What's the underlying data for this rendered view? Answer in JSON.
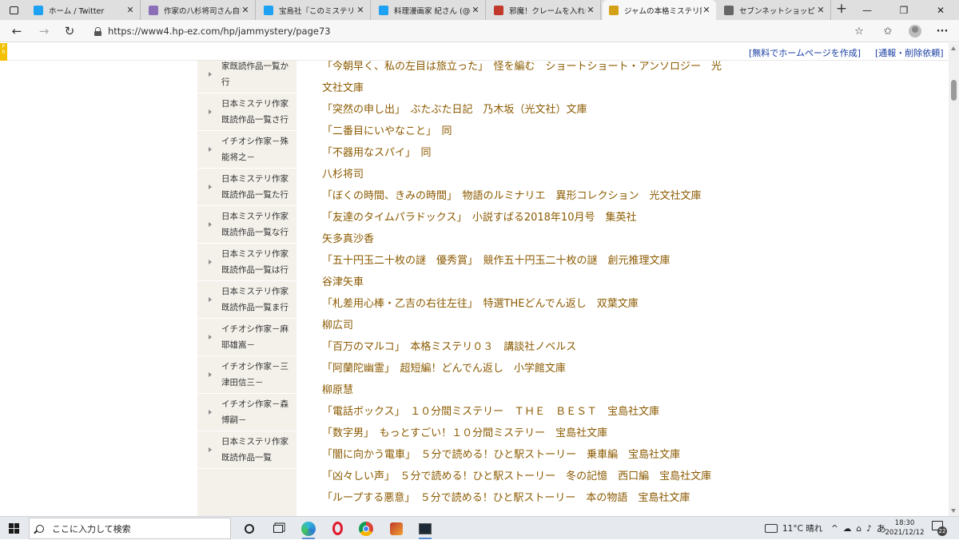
{
  "browser": {
    "tabs": [
      {
        "title": "ホーム / Twitter",
        "favicon": "twitter-icon",
        "color": "#1da1f2",
        "active": false
      },
      {
        "title": "作家の八杉将司さん自宅",
        "favicon": "news-icon",
        "color": "#8a6fb8",
        "active": false
      },
      {
        "title": "宝島社『このミステリーがすご",
        "favicon": "twitter-icon",
        "color": "#1da1f2",
        "active": false
      },
      {
        "title": "料理漫画家 紀さん (@syase",
        "favicon": "twitter-icon",
        "color": "#1da1f2",
        "active": false
      },
      {
        "title": "邪魔！クレームを入れ会社",
        "favicon": "web-icon",
        "color": "#c0392b",
        "active": false
      },
      {
        "title": "ジャムの本格ミステリ館 短",
        "favicon": "jam-icon",
        "color": "#d4a017",
        "active": true
      },
      {
        "title": "セブンネットショッピング｜本",
        "favicon": "shop-icon",
        "color": "#666666",
        "active": false
      }
    ],
    "url": "https://www4.hp-ez.com/hp/jammystery/page73"
  },
  "infobar": {
    "create_link": "[無料でホームページを作成]",
    "report_link": "[通報・削除依頼]"
  },
  "sidebar": {
    "items": [
      "家既読作品一覧か行",
      "日本ミステリ作家既読作品一覧さ行",
      "イチオシ作家－殊能将之－",
      "日本ミステリ作家既読作品一覧た行",
      "日本ミステリ作家既読作品一覧な行",
      "日本ミステリ作家既読作品一覧は行",
      "日本ミステリ作家既読作品一覧ま行",
      "イチオシ作家－麻耶雄嵩－",
      "イチオシ作家－三津田信三－",
      "イチオシ作家－森博嗣－",
      "日本ミステリ作家既読作品一覧"
    ]
  },
  "main": {
    "first_line": "「今朝早く、私の左目は旅立った」　怪を編む　ショートショート・アンソロジー　光",
    "lines": [
      "文社文庫",
      "「突然の申し出」　ぶたぶた日記　乃木坂（光文社）文庫",
      "「二番目にいやなこと」　同",
      "「不器用なスパイ」　同",
      "八杉将司",
      "「ぼくの時間、きみの時間」　物語のルミナリエ　異形コレクション　光文社文庫",
      "「友達のタイムパラドックス」　小説すばる2018年10月号　集英社",
      "矢多真沙香",
      "「五十円玉二十枚の謎　優秀賞」　競作五十円玉二十枚の謎　創元推理文庫",
      "谷津矢車",
      "「札差用心棒・乙吉の右往左往」　特選THEどんでん返し　双葉文庫",
      "柳広司",
      "「百万のマルコ」　本格ミステリ０３　講談社ノベルス",
      "「阿蘭陀幽霊」　超短編！どんでん返し　小学館文庫",
      "柳原慧",
      "「電話ボックス」　１０分間ミステリー　ＴＨＥ　ＢＥＳＴ　宝島社文庫",
      "「数字男」　もっとすごい！１０分間ミステリー　宝島社文庫",
      "「闇に向かう電車」　５分で読める！ひと駅ストーリー　乗車編　宝島社文庫",
      "「凶々しい声」　５分で読める！ひと駅ストーリー　冬の記憶　西口編　宝島社文庫",
      "「ループする悪意」　５分で読める！ひと駅ストーリー　本の物語　宝島社文庫"
    ]
  },
  "taskbar": {
    "search_placeholder": "ここに入力して検索",
    "weather": "11°C  晴れ",
    "ime": "あ",
    "time": "18:30",
    "date": "2021/12/12",
    "notification_count": "22"
  },
  "colors": {
    "content_text": "#8b5a00",
    "sidebar_bg": "#f3f1ea",
    "link": "#1a3fa3"
  }
}
